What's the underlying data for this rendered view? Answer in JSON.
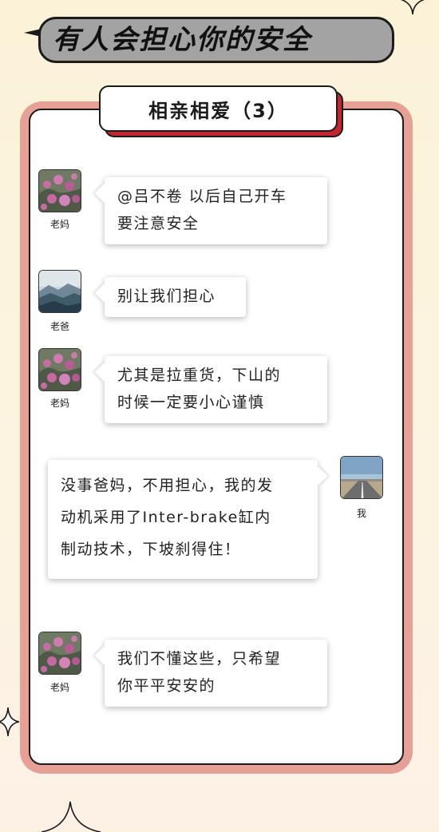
{
  "title": "有人会担心你的安全",
  "chat": {
    "group_name": "相亲相爱（3）",
    "messages": [
      {
        "sender": "老妈",
        "avatar": "flowers-photo-avatar",
        "side": "left",
        "lines": [
          "@吕不卷 以后自己开车",
          "要注意安全"
        ]
      },
      {
        "sender": "老爸",
        "avatar": "mountains-photo-avatar",
        "side": "left",
        "lines": [
          "别让我们担心"
        ]
      },
      {
        "sender": "老妈",
        "avatar": "flowers-photo-avatar",
        "side": "left",
        "lines": [
          "尤其是拉重货，下山的",
          "时候一定要小心谨慎"
        ]
      },
      {
        "sender": "我",
        "avatar": "road-photo-avatar",
        "side": "right",
        "lines": [
          "没事爸妈，不用担心，我的发",
          "动机采用了Inter-brake缸内",
          "制动技术，下坡刹得住！"
        ]
      },
      {
        "sender": "老妈",
        "avatar": "flowers-photo-avatar",
        "side": "left",
        "lines": [
          "我们不懂这些，只希望",
          "你平平安安的"
        ]
      }
    ]
  },
  "colors": {
    "background": "#fbf2d8",
    "frame": "#e6a096",
    "tag_shadow": "#c4262f",
    "title_bar": "#a3a3a3"
  }
}
